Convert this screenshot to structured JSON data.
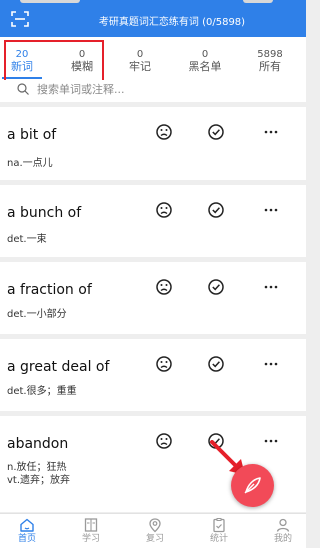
{
  "header": {
    "title": "考研真题词汇恋练有词 (0/5898)"
  },
  "tabs": [
    {
      "count": "20",
      "label": "新词",
      "active": true
    },
    {
      "count": "0",
      "label": "模糊",
      "active": false
    },
    {
      "count": "0",
      "label": "牢记",
      "active": false
    },
    {
      "count": "0",
      "label": "黑名单",
      "active": false
    },
    {
      "count": "5898",
      "label": "所有",
      "active": false
    }
  ],
  "search": {
    "placeholder": "搜索单词或注释..."
  },
  "words": [
    {
      "word": "a bit of",
      "meaning": [
        "na.一点儿"
      ]
    },
    {
      "word": "a bunch of",
      "meaning": [
        "det.一束"
      ]
    },
    {
      "word": "a fraction of",
      "meaning": [
        "det.一小部分"
      ]
    },
    {
      "word": "a great deal of",
      "meaning": [
        "det.很多；重重"
      ]
    },
    {
      "word": "abandon",
      "meaning": [
        "n.放任；狂热",
        "vt.遗弃；放弃"
      ]
    }
  ],
  "row_actions": {
    "icons": [
      "sad-face-icon",
      "check-circle-icon",
      "more-icon"
    ],
    "more_symbol": "···"
  },
  "bottom_nav": [
    {
      "label": "首页",
      "icon": "home-icon",
      "active": true
    },
    {
      "label": "学习",
      "icon": "book-icon",
      "active": false
    },
    {
      "label": "复习",
      "icon": "review-icon",
      "active": false
    },
    {
      "label": "统计",
      "icon": "stats-icon",
      "active": false
    },
    {
      "label": "我的",
      "icon": "profile-icon",
      "active": false
    }
  ],
  "colors": {
    "primary": "#2f80e8",
    "fab": "#f24a58",
    "annotation": "#e5202a",
    "background": "#eeeeee"
  }
}
